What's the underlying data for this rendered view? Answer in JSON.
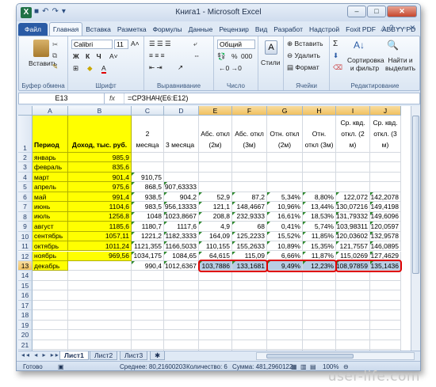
{
  "window": {
    "title": "Книга1 - Microsoft Excel"
  },
  "tabs": [
    "Файл",
    "Главная",
    "Вставка",
    "Разметка",
    "Формулы",
    "Данные",
    "Рецензир",
    "Вид",
    "Разработ",
    "Надстрой",
    "Foxit PDF",
    "ABBYY PD"
  ],
  "ribbon": {
    "paste_label": "Вставить",
    "clipboard_caption": "Буфер обмена",
    "font_name": "Calibri",
    "font_size": "11",
    "font_buttons": "Ж К Ч",
    "font_caption": "Шрифт",
    "align_caption": "Выравнивание",
    "number_format": "Общий",
    "number_caption": "Число",
    "styles_label": "Стили",
    "insert_label": "Вставить",
    "delete_label": "Удалить",
    "format_label": "Формат",
    "cells_caption": "Ячейки",
    "sort_label": "Сортировка и фильтр",
    "find_label": "Найти и выделить",
    "editing_caption": "Редактирование",
    "percent": "%",
    "thousands": "000"
  },
  "formula_bar": {
    "name_box": "E13",
    "fx": "fx",
    "formula": "=СРЗНАЧ(E6:E12)"
  },
  "columns": [
    "A",
    "B",
    "C",
    "D",
    "E",
    "F",
    "G",
    "H",
    "I",
    "J"
  ],
  "rows": [
    "1",
    "2",
    "3",
    "4",
    "5",
    "6",
    "7",
    "8",
    "9",
    "10",
    "11",
    "12",
    "13",
    "14",
    "15",
    "16",
    "17",
    "18",
    "19",
    "20",
    "21",
    "22",
    "23"
  ],
  "header_row": {
    "A": "Период",
    "B": "Доход, тыс. руб.",
    "C": "2 месяца",
    "D": "3 месяца",
    "E": "Абс. откл (2м)",
    "F": "Абс. откл (3м)",
    "G": "Отн. откл (2м)",
    "H": "Отн. откл (3м)",
    "I": "Ср. квд. откл. (2 м)",
    "J": "Ср. квд. откл. (3 м)"
  },
  "data_rows": [
    [
      "январь",
      "985,9",
      "",
      "",
      "",
      "",
      "",
      "",
      "",
      ""
    ],
    [
      "февраль",
      "835,6",
      "",
      "",
      "",
      "",
      "",
      "",
      "",
      ""
    ],
    [
      "март",
      "901,4",
      "910,75",
      "",
      "",
      "",
      "",
      "",
      "",
      ""
    ],
    [
      "апрель",
      "975,6",
      "868,5",
      "907,63333",
      "",
      "",
      "",
      "",
      "",
      ""
    ],
    [
      "май",
      "991,4",
      "938,5",
      "904,2",
      "52,9",
      "87,2",
      "5,34%",
      "8,80%",
      "122,072",
      "142,2078"
    ],
    [
      "июнь",
      "1104,6",
      "983,5",
      "956,13333",
      "121,1",
      "148,4667",
      "10,96%",
      "13,44%",
      "130,07216",
      "149,4198"
    ],
    [
      "июль",
      "1256,8",
      "1048",
      "1023,8667",
      "208,8",
      "232,9333",
      "16,61%",
      "18,53%",
      "131,79332",
      "149,6096"
    ],
    [
      "август",
      "1185,6",
      "1180,7",
      "1117,6",
      "4,9",
      "68",
      "0,41%",
      "5,74%",
      "103,98311",
      "120,0597"
    ],
    [
      "сентябрь",
      "1057,11",
      "1221,2",
      "1182,3333",
      "164,09",
      "125,2233",
      "15,52%",
      "11,85%",
      "120,03602",
      "132,9578"
    ],
    [
      "октябрь",
      "1011,24",
      "1121,355",
      "1166,5033",
      "110,155",
      "155,2633",
      "10,89%",
      "15,35%",
      "121,7557",
      "146,0895"
    ],
    [
      "ноябрь",
      "969,56",
      "1034,175",
      "1084,65",
      "64,615",
      "115,09",
      "6,66%",
      "11,87%",
      "115,0269",
      "127,4629"
    ],
    [
      "декабрь",
      "",
      "990,4",
      "1012,6367",
      "103,7886",
      "133,1681",
      "9,49%",
      "12,23%",
      "108,97859",
      "135,1436"
    ]
  ],
  "sheets": [
    "Лист1",
    "Лист2",
    "Лист3"
  ],
  "status": {
    "ready": "Готово",
    "average": "Среднее: 80,21600203",
    "count": "Количество: 6",
    "sum": "Сумма: 481,2960122",
    "zoom": "100%"
  },
  "watermark": "user-life.com"
}
